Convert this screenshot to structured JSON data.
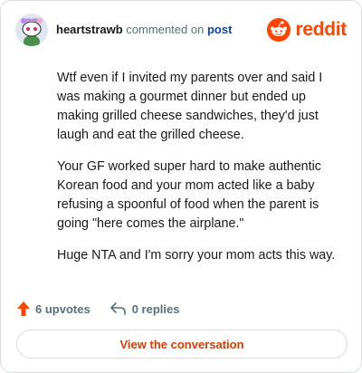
{
  "header": {
    "username": "heartstrawb",
    "action_text": "commented on",
    "post_link": "post",
    "brand": "reddit"
  },
  "comment": {
    "paragraphs": [
      "Wtf even if I invited my parents over and said I was making a gourmet dinner but ended up making grilled cheese sandwiches, they'd just laugh and eat the grilled cheese.",
      "Your GF worked super hard to make authentic Korean food and your mom acted like a baby refusing a spoonful of food when the parent is going \"here comes the airplane.\"",
      "Huge NTA and I'm sorry your mom acts this way."
    ]
  },
  "actions": {
    "upvotes": "6 upvotes",
    "replies": "0 replies"
  },
  "cta": {
    "label": "View the conversation"
  },
  "colors": {
    "accent": "#ff4500",
    "link": "#0a449b",
    "muted": "#576f76",
    "cta_text": "#d93a00"
  },
  "icons": {
    "avatar": "snoo-avatar",
    "brand": "reddit-snoo-logo",
    "upvote": "upvote-arrow-icon",
    "reply": "reply-arrow-icon"
  }
}
